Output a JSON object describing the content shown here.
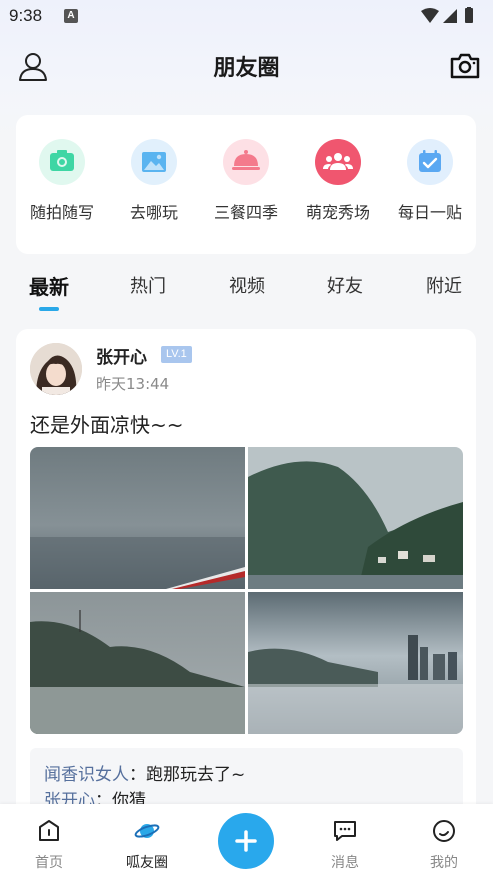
{
  "status_bar": {
    "time": "9:38",
    "notification_letter": "A"
  },
  "header": {
    "title": "朋友圈"
  },
  "quick_menu": [
    {
      "label": "随拍随写",
      "icon": "camera-icon",
      "color": "#3ed6a4"
    },
    {
      "label": "去哪玩",
      "icon": "picture-icon",
      "color": "#5ab4f0"
    },
    {
      "label": "三餐四季",
      "icon": "food-cloche-icon",
      "color": "#f47a8c"
    },
    {
      "label": "萌宠秀场",
      "icon": "group-icon",
      "color": "#f0566f"
    },
    {
      "label": "每日一贴",
      "icon": "calendar-check-icon",
      "color": "#5aa8f2"
    }
  ],
  "tabs": [
    {
      "label": "最新",
      "active": true
    },
    {
      "label": "热门"
    },
    {
      "label": "视频"
    },
    {
      "label": "好友"
    },
    {
      "label": "附近"
    }
  ],
  "post": {
    "author": "张开心",
    "level": "LV.1",
    "time": "昨天13:44",
    "text": "还是外面凉快~~",
    "photos": 4,
    "comments": [
      {
        "user": "闻香识女人",
        "sep": "：",
        "text": "跑那玩去了~"
      },
      {
        "user": "张开心",
        "sep": "：",
        "text": "你猜"
      }
    ]
  },
  "bottom_nav": [
    {
      "label": "首页",
      "icon": "home-icon"
    },
    {
      "label": "呱友圈",
      "icon": "planet-icon",
      "active": true
    },
    {
      "label": "",
      "icon": "plus-icon"
    },
    {
      "label": "消息",
      "icon": "message-icon"
    },
    {
      "label": "我的",
      "icon": "profile-icon"
    }
  ],
  "colors": {
    "accent": "#29a8ec",
    "badge": "#a9c6ee",
    "comment_user": "#56709d"
  }
}
